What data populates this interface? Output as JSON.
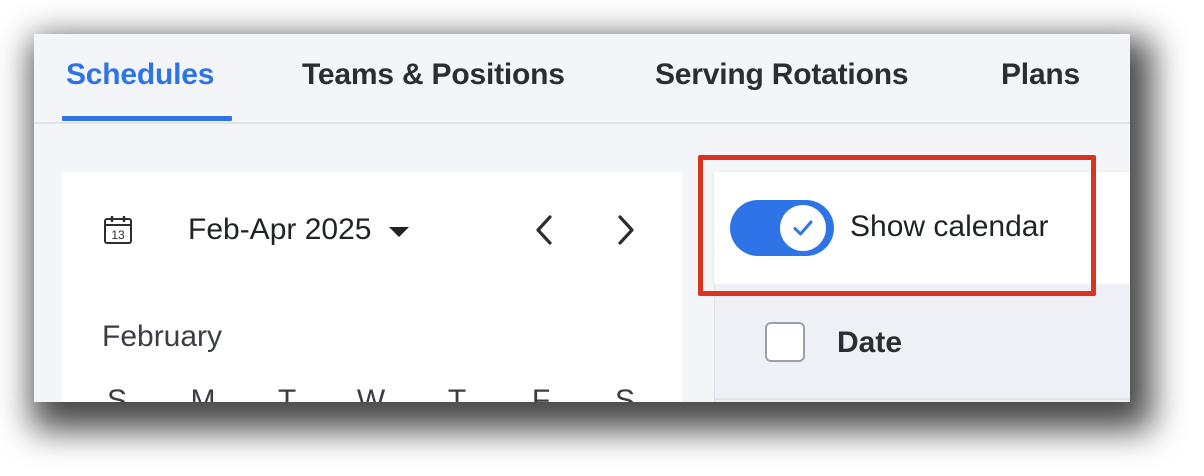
{
  "tabs": [
    {
      "label": "Schedules",
      "active": true
    },
    {
      "label": "Teams & Positions",
      "active": false
    },
    {
      "label": "Serving Rotations",
      "active": false
    },
    {
      "label": "Plans",
      "active": false
    }
  ],
  "calendar": {
    "icon": "calendar-13-icon",
    "icon_day": "13",
    "range_label": "Feb-Apr 2025",
    "prev_icon": "chevron-left-icon",
    "next_icon": "chevron-right-icon",
    "month": "February",
    "weekdays": [
      "S",
      "M",
      "T",
      "W",
      "T",
      "F",
      "S"
    ]
  },
  "toggle": {
    "label": "Show calendar",
    "checked": true,
    "icon": "check-icon"
  },
  "table": {
    "select_all_checked": false,
    "columns": [
      "Date"
    ]
  },
  "colors": {
    "accent": "#2f74e6",
    "highlight": "#d7351f",
    "background": "#f4f5f9"
  }
}
